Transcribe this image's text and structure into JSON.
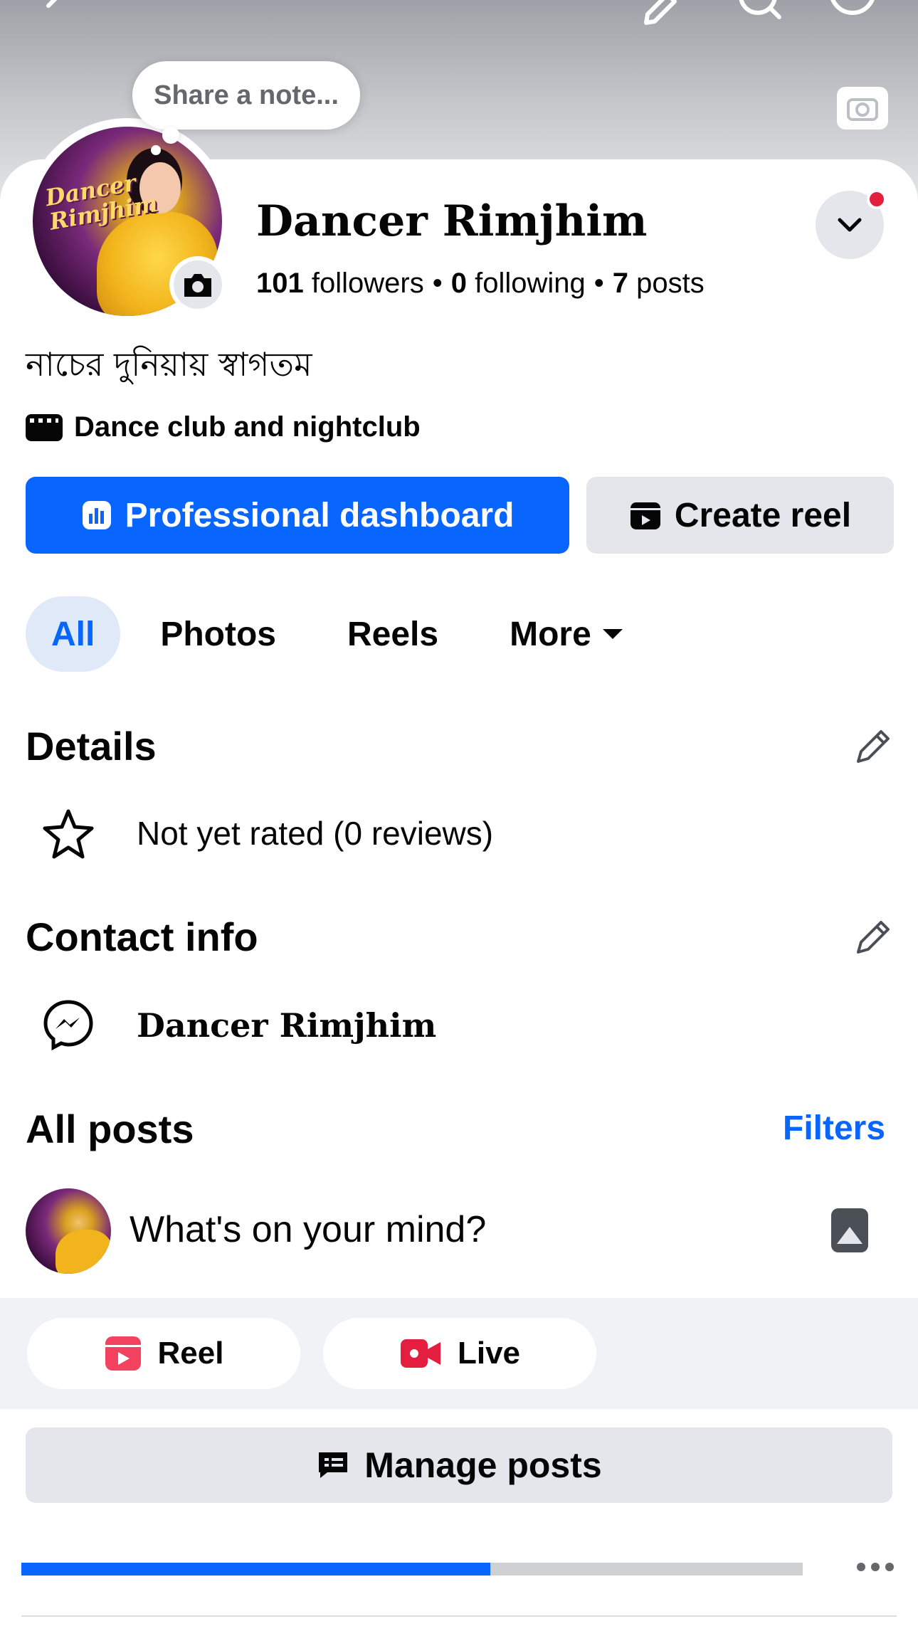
{
  "note_bubble": {
    "text": "Share a note..."
  },
  "profile": {
    "name": "Dancer Rimjhim",
    "followers_count": "101",
    "followers_label": "followers",
    "following_count": "0",
    "following_label": "following",
    "posts_count": "7",
    "posts_label": "posts",
    "bio": "নাচের দুনিয়ায় স্বাগতম",
    "category": "Dance club and nightclub"
  },
  "actions": {
    "primary_label": "Professional dashboard",
    "secondary_label": "Create reel"
  },
  "tabs": [
    {
      "label": "All",
      "active": true
    },
    {
      "label": "Photos"
    },
    {
      "label": "Reels"
    },
    {
      "label": "More"
    }
  ],
  "details": {
    "title": "Details",
    "rating_text": "Not yet rated (0 reviews)"
  },
  "contact": {
    "title": "Contact info",
    "messenger_name": "Dancer Rimjhim"
  },
  "posts": {
    "title": "All posts",
    "filters_label": "Filters",
    "composer_placeholder": "What's on your mind?",
    "reel_label": "Reel",
    "live_label": "Live",
    "manage_label": "Manage posts"
  },
  "progress": {
    "fraction": 0.6
  },
  "colors": {
    "accent": "#0866ff",
    "button_grey": "#e4e6eb",
    "notification": "#e41e3f",
    "reel_red": "#f3425f",
    "live_red": "#e41e3f"
  }
}
